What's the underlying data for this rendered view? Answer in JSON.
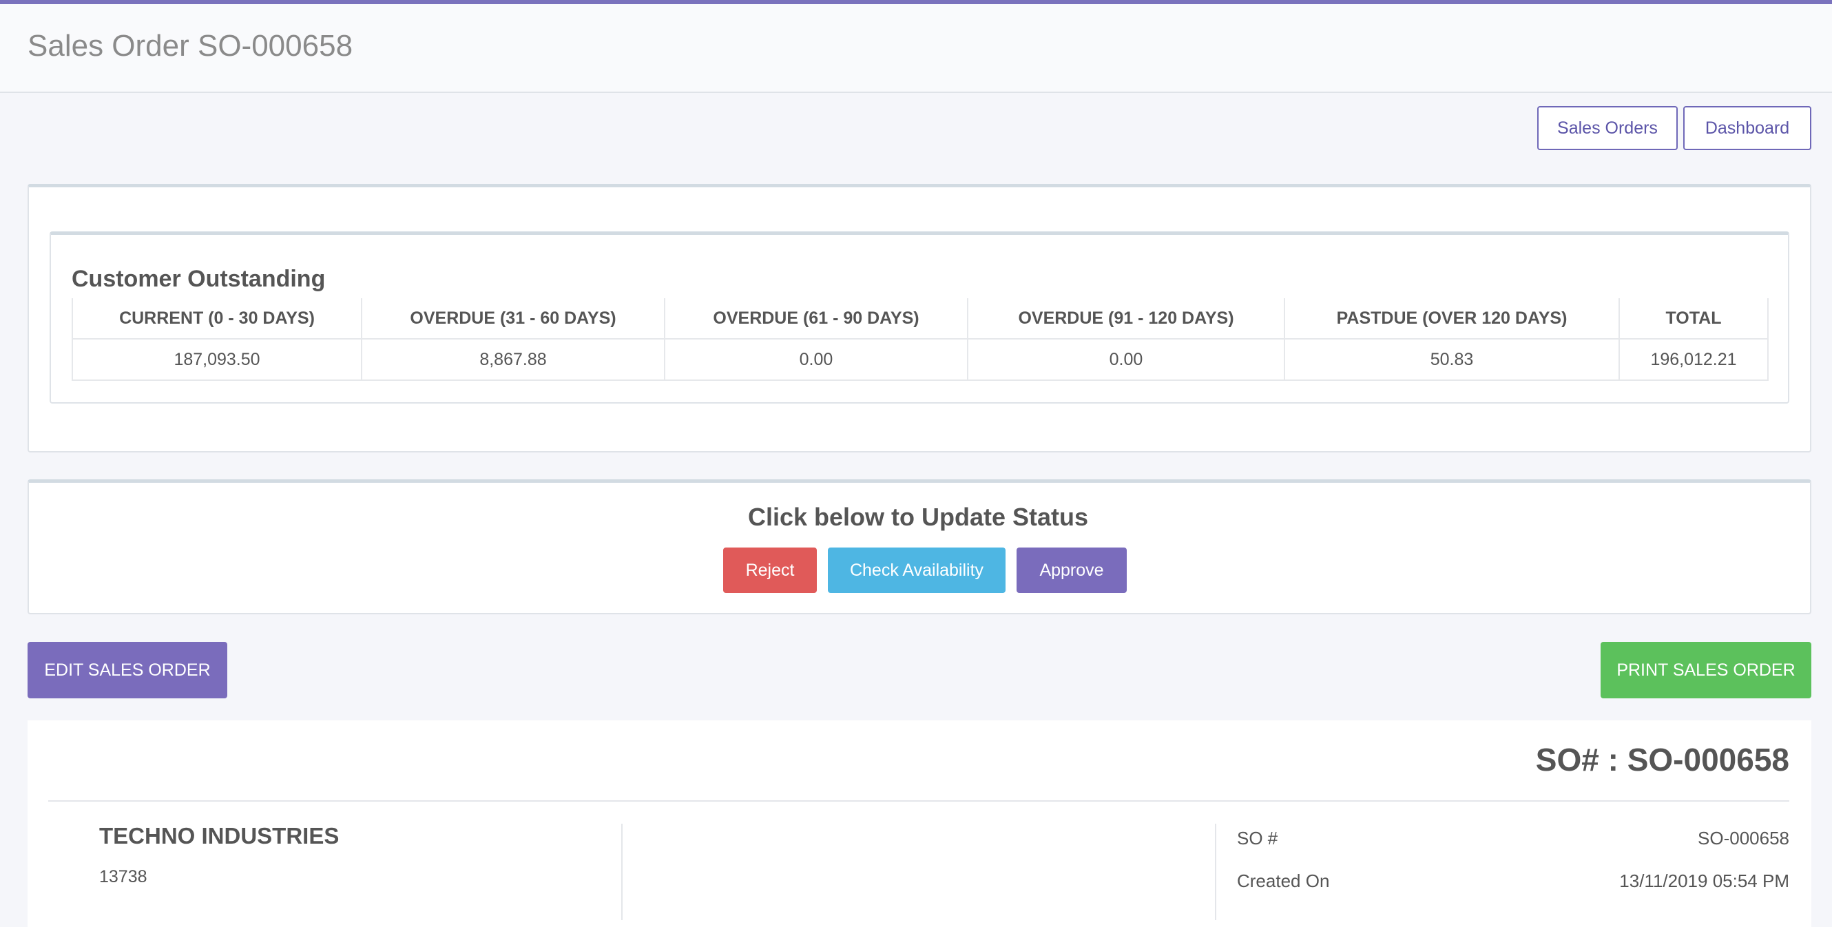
{
  "colors": {
    "accent": "#7a72bd",
    "reject": "#e05a59",
    "check": "#4eb6e3",
    "approve": "#7a6cbc",
    "edit": "#7a6cbc",
    "print": "#5cc15c"
  },
  "header": {
    "title": "Sales Order SO-000658"
  },
  "nav": {
    "sales_orders_label": "Sales Orders",
    "dashboard_label": "Dashboard"
  },
  "outstanding": {
    "title": "Customer Outstanding",
    "columns": [
      "CURRENT (0 - 30 DAYS)",
      "OVERDUE (31 - 60 DAYS)",
      "OVERDUE (61 - 90 DAYS)",
      "OVERDUE (91 - 120 DAYS)",
      "PASTDUE (OVER 120 DAYS)",
      "TOTAL"
    ],
    "values": [
      "187,093.50",
      "8,867.88",
      "0.00",
      "0.00",
      "50.83",
      "196,012.21"
    ]
  },
  "status": {
    "title": "Click below to Update Status",
    "reject_label": "Reject",
    "check_label": "Check Availability",
    "approve_label": "Approve"
  },
  "actions": {
    "edit_label": "EDIT SALES ORDER",
    "print_label": "PRINT SALES ORDER"
  },
  "document": {
    "so_heading": "SO# : SO-000658",
    "company_name": "TECHNO INDUSTRIES",
    "company_code": "13738",
    "meta": [
      {
        "label": "SO #",
        "value": "SO-000658"
      },
      {
        "label": "Created On",
        "value": "13/11/2019 05:54 PM"
      }
    ]
  }
}
